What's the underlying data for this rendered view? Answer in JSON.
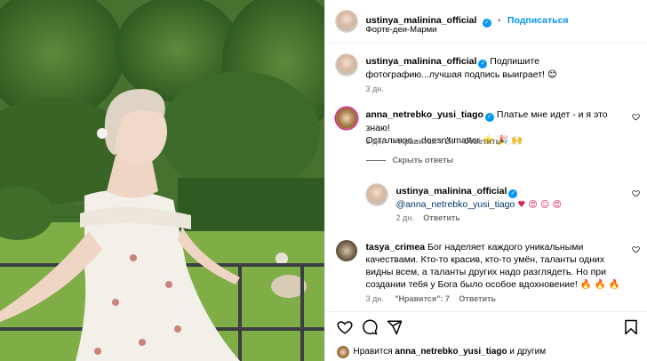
{
  "header": {
    "username": "ustinya_malinina_official",
    "follow_label": "Подписаться",
    "separator": "•",
    "location": "Форте-деи-Марми"
  },
  "caption": {
    "username": "ustinya_malinina_official",
    "text": "Подпишите фотографию...лучшая подпись выиграет! 😊",
    "time": "3 дн."
  },
  "comments": [
    {
      "username": "anna_netrebko_yusi_tiago",
      "text_line1": "Платье мне идет - и я это знаю!",
      "text_line2": "Остальное - doesn't matter ⭐ 🎉 🙌",
      "time": "3 дн.",
      "likes": "\"Нравится\": 24",
      "reply": "Ответить",
      "hide_replies": "Скрыть ответы"
    },
    {
      "username": "ustinya_malinina_official",
      "text_line1": "@anna_netrebko_yusi_tiago",
      "hearts": "♥ 😍 ☺ 😍",
      "time": "2 дн.",
      "reply": "Ответить"
    },
    {
      "username": "tasya_crimea",
      "text_line1": "Бог наделяет каждого уникальными",
      "text_line2": "качествами. Кто-то красив, кто-то умён, таланты одних",
      "text_line3": "видны всем, а таланты других надо разглядеть. Но при",
      "text_line4": "создании тебя у Бога было особое вдохновение! 🔥 🔥 🔥",
      "time": "3 дн.",
      "likes": "\"Нравится\": 7",
      "reply": "Ответить"
    }
  ],
  "likes_bar": {
    "prefix": "Нравится",
    "user": "anna_netrebko_yusi_tiago",
    "suffix": "и другим"
  },
  "colors": {
    "accent": "#0095f6",
    "muted": "#737373",
    "border": "#efefef"
  }
}
